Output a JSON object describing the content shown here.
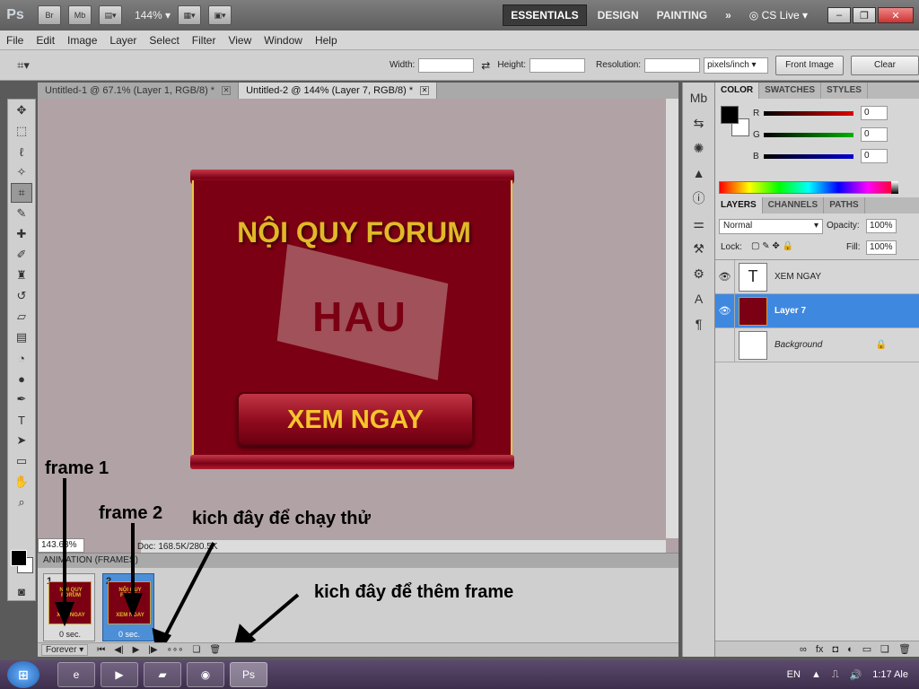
{
  "app": {
    "logo": "Ps",
    "bridge_label": "Br",
    "minibridge_label": "Mb",
    "zoom": "144%",
    "workspaces": [
      "ESSENTIALS",
      "DESIGN",
      "PAINTING"
    ],
    "more_workspaces": "»",
    "cslive": "CS Live"
  },
  "menu": [
    "File",
    "Edit",
    "Image",
    "Layer",
    "Select",
    "Filter",
    "View",
    "Window",
    "Help"
  ],
  "options": {
    "width_label": "Width:",
    "height_label": "Height:",
    "resolution_label": "Resolution:",
    "resolution_unit": "pixels/inch",
    "front_image": "Front Image",
    "clear": "Clear"
  },
  "doc_tabs": [
    {
      "title": "Untitled-1 @ 67.1% (Layer 1, RGB/8) *",
      "active": false
    },
    {
      "title": "Untitled-2 @ 144% (Layer 7, RGB/8) *",
      "active": true
    }
  ],
  "status": {
    "zoom": "143.68%",
    "doc": "Doc: 168.5K/280.5K"
  },
  "artwork": {
    "title": "NỘI QUY FORUM",
    "logo": "HAU",
    "button": "XEM NGAY"
  },
  "annotations": {
    "frame1": "frame 1",
    "frame2": "frame 2",
    "play_hint": "kich đây để chạy thử",
    "add_hint": "kich đây để thêm frame"
  },
  "animation": {
    "header": "ANIMATION (FRAMES)",
    "frames": [
      {
        "num": "1",
        "time": "0 sec.",
        "thumb_title": "NỘI QUY FORUM",
        "thumb_btn": "XEM NGAY"
      },
      {
        "num": "2",
        "time": "0 sec.",
        "thumb_title": "NỘI QUY FORUM",
        "thumb_btn": "XEM NGAY"
      }
    ],
    "loop": "Forever"
  },
  "color_panel": {
    "tabs": [
      "COLOR",
      "SWATCHES",
      "STYLES"
    ],
    "channels": [
      {
        "label": "R",
        "value": "0",
        "color": "#e00000"
      },
      {
        "label": "G",
        "value": "0",
        "color": "#00b000"
      },
      {
        "label": "B",
        "value": "0",
        "color": "#0000d0"
      }
    ]
  },
  "layers_panel": {
    "tabs": [
      "LAYERS",
      "CHANNELS",
      "PATHS"
    ],
    "blend_mode": "Normal",
    "opacity_label": "Opacity:",
    "opacity": "100%",
    "lock_label": "Lock:",
    "fill_label": "Fill:",
    "fill": "100%",
    "layers": [
      {
        "name": "XEM NGAY",
        "type": "text",
        "visible": true,
        "selected": false
      },
      {
        "name": "Layer 7",
        "type": "image",
        "visible": true,
        "selected": true
      },
      {
        "name": "Background",
        "type": "background",
        "visible": false,
        "selected": false
      }
    ]
  },
  "taskbar": {
    "lang": "EN",
    "clock": "1:17 Ale"
  }
}
